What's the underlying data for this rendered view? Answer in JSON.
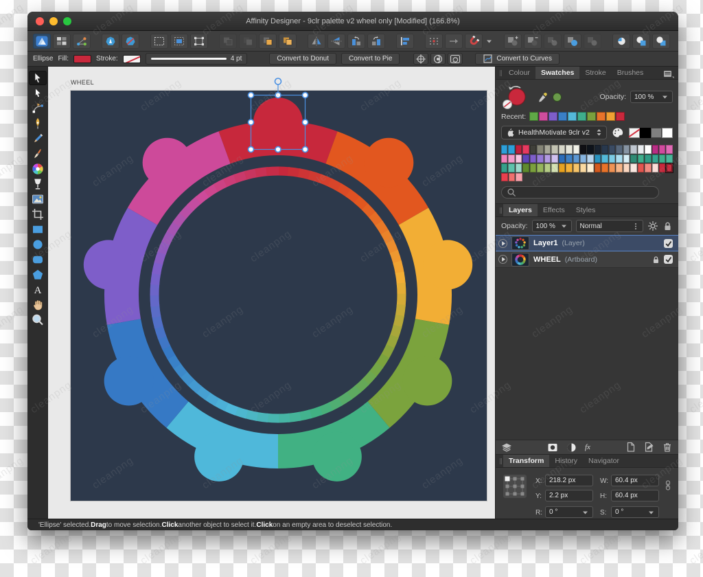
{
  "watermark": "cleanpng",
  "window": {
    "title": "Affinity Designer - 9clr palette v2 wheel only [Modified] (166.8%)",
    "traffic_lights": [
      "#ff5f57",
      "#febc2e",
      "#28c840"
    ]
  },
  "toolbar": {
    "groups": [
      [
        "affinity-logo",
        "artboard-grid",
        "constraints"
      ],
      [
        "vector-persona",
        "pixel-persona"
      ],
      [
        "marquee-select",
        "marquee-fill",
        "marquee-transform"
      ],
      [
        "order-back",
        "order-backward",
        "order-forward",
        "order-front"
      ],
      [
        "flip-horizontal",
        "flip-vertical",
        "rotate-ccw",
        "rotate-cw"
      ],
      [
        "align"
      ],
      [
        "snap-grid",
        "snap-move",
        "magnet"
      ],
      [
        "bool-add",
        "bool-subtract",
        "bool-intersect",
        "bool-xor",
        "bool-divide"
      ],
      [
        "insert-behind",
        "insert-top",
        "insert-inside"
      ]
    ],
    "dim_buttons": [
      "order-back",
      "order-backward",
      "bool-intersect",
      "bool-divide"
    ]
  },
  "context_toolbar": {
    "tool_label": "Ellipse",
    "fill_label": "Fill:",
    "fill_color": "#c9283c",
    "stroke_label": "Stroke:",
    "stroke_width": "4 pt",
    "convert_donut": "Convert to Donut",
    "convert_pie": "Convert to Pie",
    "convert_curves": "Convert to Curves",
    "icon_buttons": [
      "anchor-target",
      "show-handles",
      "cycle-rotation"
    ]
  },
  "tools": [
    "move",
    "node",
    "point-transform",
    "pen",
    "pencil",
    "vector-brush",
    "fill-gradient",
    "transparency",
    "place-image",
    "vector-crop",
    "rectangle",
    "ellipse",
    "rounded-rectangle",
    "polygon",
    "artistic-text",
    "view-hand",
    "zoom"
  ],
  "canvas": {
    "artboard_label": "WHEEL",
    "artboard_bg": "#2d394b",
    "selection_color": "#4a90e2"
  },
  "wheel": {
    "segments": [
      {
        "name": "red",
        "color": "#c7283c"
      },
      {
        "name": "orange",
        "color": "#e2571f"
      },
      {
        "name": "yellow",
        "color": "#f2ae35"
      },
      {
        "name": "olive",
        "color": "#7ba33d"
      },
      {
        "name": "green",
        "color": "#41b183"
      },
      {
        "name": "cyan",
        "color": "#4fb8da"
      },
      {
        "name": "blue",
        "color": "#3679c5"
      },
      {
        "name": "purple",
        "color": "#7e5ec9"
      },
      {
        "name": "magenta",
        "color": "#cd4a9a"
      }
    ]
  },
  "swatches_panel": {
    "tabs": [
      "Colour",
      "Swatches",
      "Stroke",
      "Brushes"
    ],
    "active_tab": 1,
    "opacity_label": "Opacity:",
    "opacity_value": "100 %",
    "recent_label": "Recent:",
    "recent": [
      "#5fa846",
      "#cf4d9d",
      "#7e5ec9",
      "#3a7fc6",
      "#54b9d9",
      "#3fae8c",
      "#7ba03d",
      "#e8732a",
      "#f0a032",
      "#c9283c"
    ],
    "palette_name": "HealthMotivate 9clr v2",
    "quick_swatches": [
      "none",
      "#000000",
      "#808080",
      "#ffffff"
    ],
    "grid": [
      [
        "#2d9fd9",
        "#2d9fd9",
        "#c1203e",
        "#e63a60",
        "#3f3f39",
        "#848476",
        "#a8a899",
        "#c2c2b2",
        "#d6d6c8",
        "#e6e6da",
        "#f1f1e7",
        "#101014",
        "#0e131b",
        "#1a2330",
        "#28384d",
        "#3a4b63",
        "#57677b",
        "#8794a3",
        "#bfc6cf",
        "#e9ecef",
        "#ffffff",
        "#b92d84",
        "#d14a9e",
        "#e06ab5"
      ],
      [
        "#ef83bd",
        "#f29ccb",
        "#f8c3e0",
        "#5f45b8",
        "#7e5ec9",
        "#9579d6",
        "#b29ae2",
        "#d0c0ee",
        "#2b6cb8",
        "#3a7fc6",
        "#5c97d2",
        "#86b4e0",
        "#b4d2ec",
        "#2a93c0",
        "#54b9d9",
        "#7ccbe4",
        "#aadcee",
        "#d6eef6",
        "#2f8a74",
        "#3fae8c",
        "#2f9c85",
        "#35a591",
        "#3fae8c",
        "#49b79a"
      ],
      [
        "#35a08a",
        "#5fc2ab",
        "#9cd9ca",
        "#5f8a2e",
        "#7ba03d",
        "#95b55c",
        "#b5cc86",
        "#d6e4b4",
        "#e8a21e",
        "#f2b13a",
        "#f6c46a",
        "#fad9a0",
        "#fdedd0",
        "#d45a1e",
        "#e8732a",
        "#ef9254",
        "#f5b488",
        "#fad6c0",
        "#f9e8e0",
        "#e2554f",
        "#f08a80",
        "#fbded8",
        "#c9283c",
        "#c9283c"
      ],
      [
        "#e8404e",
        "#f0706e",
        "#f8a2ac"
      ]
    ],
    "selected_swatch": {
      "row": 2,
      "col": 23
    }
  },
  "layers_panel": {
    "tabs": [
      "Layers",
      "Effects",
      "Styles"
    ],
    "active_tab": 0,
    "opacity_label": "Opacity:",
    "opacity_value": "100 %",
    "blend_mode": "Normal",
    "fx_label": "fx",
    "layers": [
      {
        "name": "Layer1",
        "type": "(Layer)",
        "selected": true,
        "locked": false
      },
      {
        "name": "WHEEL",
        "type": "(Artboard)",
        "selected": false,
        "locked": true
      }
    ]
  },
  "transform_panel": {
    "tabs": [
      "Transform",
      "History",
      "Navigator"
    ],
    "active_tab": 0,
    "x_label": "X:",
    "x": "218.2 px",
    "y_label": "Y:",
    "y": "2.2 px",
    "w_label": "W:",
    "w": "60.4 px",
    "h_label": "H:",
    "h": "60.4 px",
    "r_label": "R:",
    "r": "0 °",
    "s_label": "S:",
    "s": "0 °"
  },
  "status_bar": {
    "parts": [
      {
        "text": "'Ellipse' selected. "
      },
      {
        "text": "Drag",
        "bold": true
      },
      {
        "text": " to move selection. "
      },
      {
        "text": "Click",
        "bold": true
      },
      {
        "text": " another object to select it. "
      },
      {
        "text": "Click",
        "bold": true
      },
      {
        "text": " on an empty area to deselect selection."
      }
    ]
  }
}
